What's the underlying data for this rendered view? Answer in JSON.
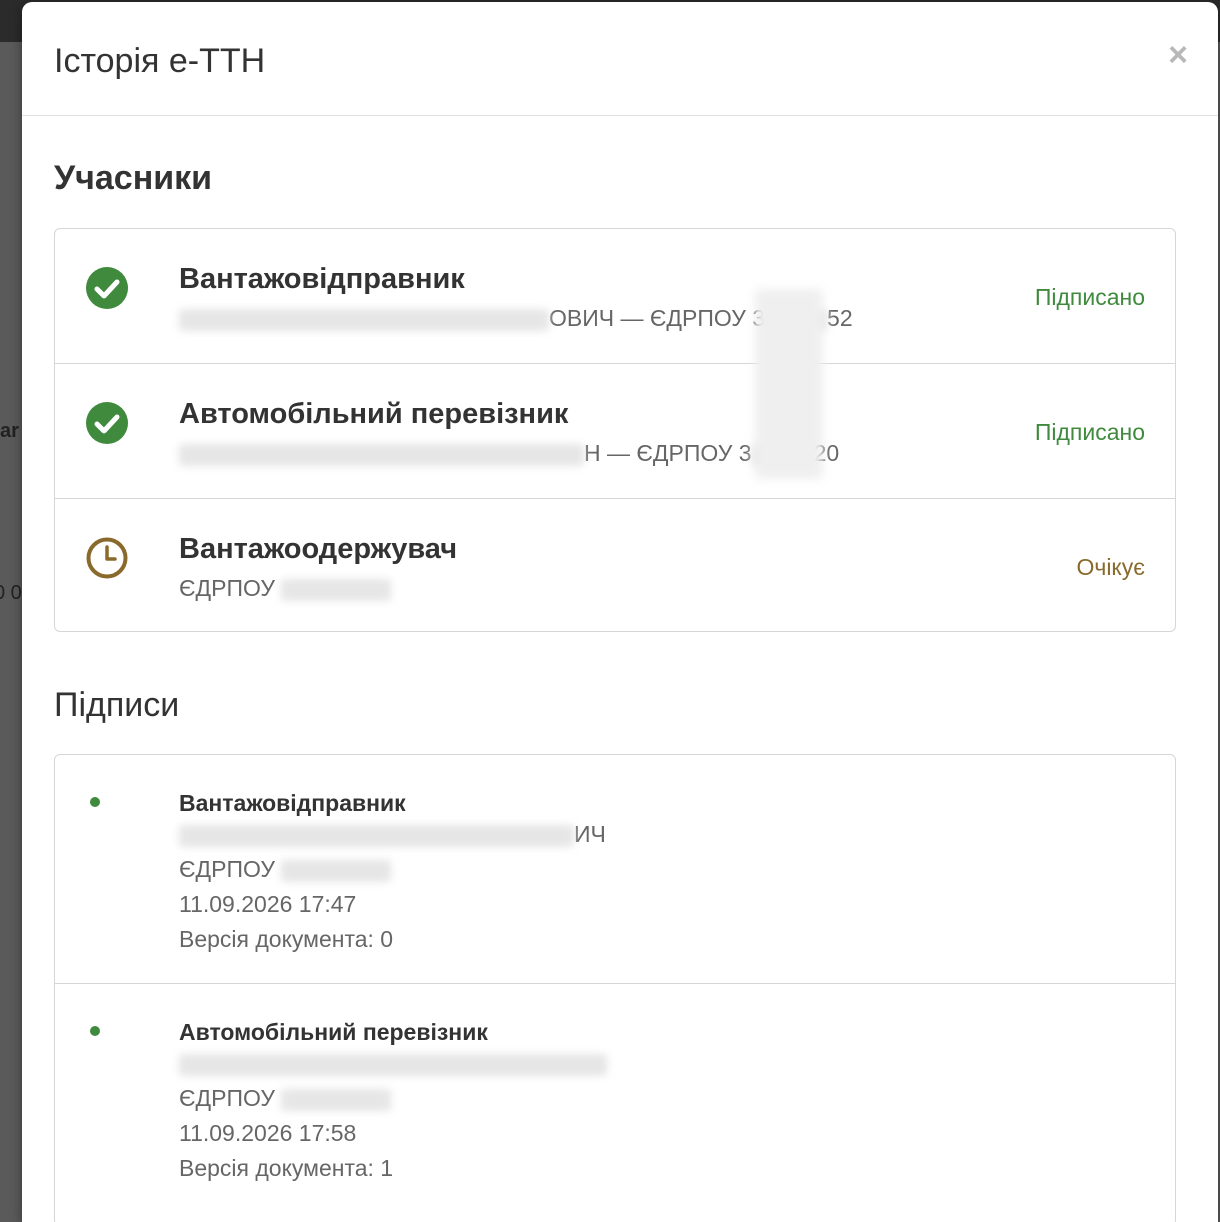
{
  "modal": {
    "title": "Історія е-ТТН",
    "close_label": "×"
  },
  "backdrop": {
    "fragment_1": "ar",
    "fragment_2": "0 0"
  },
  "participants": {
    "title": "Учасники",
    "items": [
      {
        "role": "Вантажовідправник",
        "detail_visible": "ОВИЧ — ЄДРПОУ 3",
        "detail_suffix": "52",
        "status": "Підписано",
        "icon": "check-circle-icon",
        "color": "#3f8a3d"
      },
      {
        "role": "Автомобільний перевізник",
        "detail_visible": "Н — ЄДРПОУ 3",
        "detail_suffix": "20",
        "status": "Підписано",
        "icon": "check-circle-icon",
        "color": "#3f8a3d"
      },
      {
        "role": "Вантажоодержувач",
        "detail_visible": "ЄДРПОУ",
        "status": "Очікує",
        "icon": "clock-icon",
        "color": "#8a6a2c"
      }
    ]
  },
  "signatures": {
    "title": "Підписи",
    "items": [
      {
        "role": "Вантажовідправник",
        "name_suffix": "ИЧ",
        "edrpou_label": "ЄДРПОУ",
        "datetime": "11.09.2026 17:47",
        "version": "Версія документа: 0"
      },
      {
        "role": "Автомобільний перевізник",
        "name_suffix": "",
        "edrpou_label": "ЄДРПОУ",
        "datetime": "11.09.2026 17:58",
        "version": "Версія документа: 1"
      }
    ]
  }
}
